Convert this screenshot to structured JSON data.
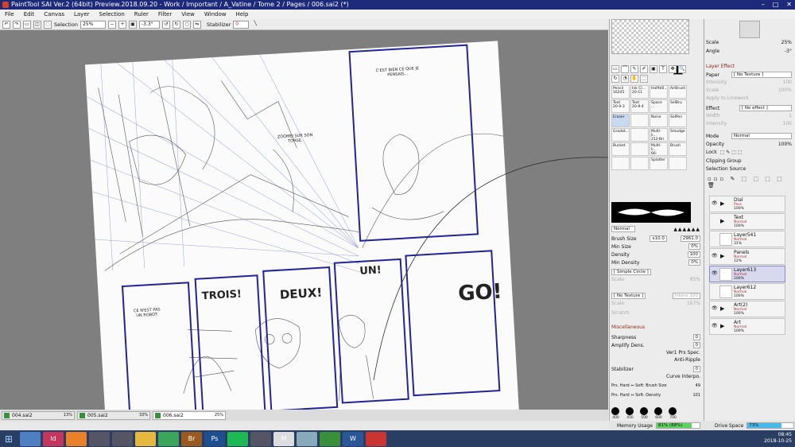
{
  "window": {
    "title": "PaintTool SAI Ver.2 (64bit) Preview.2018.09.20 - Work / Important / A_Vatine / Tome 2 / Pages / 006.sai2 (*)",
    "minimize": "–",
    "maximize": "□",
    "close": "✕"
  },
  "menu": [
    "File",
    "Edit",
    "Canvas",
    "Layer",
    "Selection",
    "Ruler",
    "Filter",
    "View",
    "Window",
    "Help"
  ],
  "toolbar": {
    "selection_label": "Selection",
    "zoom": "25%",
    "angle": "-3.3°",
    "stabilizer_label": "Stabilizer",
    "stabilizer_value": "0"
  },
  "comic": {
    "bubble1": "C'EST BIEN CE QUE JE PENSAIS...",
    "bubble2": "ZOOMEI SUR SON TORSE.",
    "bubble3": "CE N'EST PAS UN ROBOT.",
    "sfx_trois": "TROIS!",
    "sfx_deux": "DEUX!",
    "sfx_un": "UN!",
    "sfx_go": "GO!"
  },
  "file_tabs": [
    {
      "name": "004.sai2",
      "zoom": "13%"
    },
    {
      "name": "005.sai2",
      "zoom": "33%"
    },
    {
      "name": "006.sai2",
      "zoom": "25%"
    }
  ],
  "tools": {
    "icons": [
      "▭",
      "⌒",
      "✎",
      "✐",
      "▣",
      "T",
      "✥",
      "🔍",
      "↻",
      "◔",
      "✋",
      "⬚"
    ],
    "brushes": [
      {
        "name": "Pencil",
        "size": "16245"
      },
      {
        "name": "Ink Cl...",
        "size": "20-11"
      },
      {
        "name": "Halftd0...",
        "size": ""
      },
      {
        "name": "AirBrush",
        "size": ""
      },
      {
        "name": "Text",
        "size": "20-9-3"
      },
      {
        "name": "Text",
        "size": "20-9-4"
      },
      {
        "name": "Space ...",
        "size": ""
      },
      {
        "name": "SelBru",
        "size": ""
      },
      {
        "name": "Eraser",
        "size": ""
      },
      {
        "name": "",
        "size": ""
      },
      {
        "name": "Noise",
        "size": ""
      },
      {
        "name": "SelPen",
        "size": ""
      },
      {
        "name": "Gradat...",
        "size": ""
      },
      {
        "name": "",
        "size": ""
      },
      {
        "name": "Multi-li...",
        "size": "212-Bri"
      },
      {
        "name": "Smudge",
        "size": ""
      },
      {
        "name": "Bucket",
        "size": ""
      },
      {
        "name": "",
        "size": ""
      },
      {
        "name": "Multi-li...",
        "size": "66-Bright"
      },
      {
        "name": "Brush",
        "size": ""
      },
      {
        "name": "",
        "size": ""
      },
      {
        "name": "",
        "size": ""
      },
      {
        "name": "Splatter",
        "size": ""
      },
      {
        "name": "",
        "size": ""
      }
    ],
    "blend_mode": "Normal",
    "brush_size_label": "Brush Size",
    "brush_size_mult": "x10.0",
    "brush_size": "2961.0",
    "min_size_label": "Min Size",
    "min_size": "0%",
    "density_label": "Density",
    "density": "100",
    "min_density_label": "Min Density",
    "min_density": "0%",
    "shape": "[ Simple Circle ]",
    "shape_scale_label": "Scale",
    "shape_scale": "95%",
    "texture": "[ No Texture ]",
    "texture_scale_label": "Scale",
    "texture_scale": "167%",
    "texture_intensity": "Intens 100",
    "scratch": "Scratch",
    "misc_title": "Miscellaneous",
    "sharpness_label": "Sharpness",
    "sharpness": "0",
    "amplify_label": "Amplify Dens.",
    "amplify": "0",
    "ver1": "Ver1 Prs Spec.",
    "antiripple": "Anti-Ripple",
    "stabilizer_label": "Stabilizer",
    "stabilizer": "0",
    "curve": "Curve Interpo.",
    "prs_size": "Prs. Hard ⇔ Soft: Brush Size",
    "prs_size_val": "49",
    "prs_density": "Prs. Hard ⇔ Soft: Density",
    "prs_density_val": "101",
    "dot_sizes": [
      "400",
      "450",
      "500",
      "600",
      "700"
    ]
  },
  "right": {
    "scale_label": "Scale",
    "scale": "25%",
    "angle_label": "Angle",
    "angle": "-3°",
    "layer_effect_title": "Layer Effect",
    "paper_label": "Paper",
    "paper_value": "[ No Texture ]",
    "intensity_label": "Intensity",
    "intensity": "100",
    "scale2_label": "Scale",
    "scale2": "100%",
    "apply_lineart": "Apply to Linework",
    "effect_label": "Effect",
    "effect_value": "[ No effect ]",
    "width_label": "Width",
    "width": "1",
    "intensity2_label": "Intensity",
    "intensity2": "100",
    "mode_label": "Mode",
    "mode_value": "Normal",
    "opacity_label": "Opacity",
    "opacity": "100%",
    "lock_label": "Lock",
    "clipping_group": "Clipping Group",
    "selection_source": "Selection Source",
    "layers": [
      {
        "name": "Dial",
        "mode": "Pass",
        "opacity": "100%",
        "folder": true,
        "visible": true,
        "selected": false
      },
      {
        "name": "Text",
        "mode": "Normal",
        "opacity": "100%",
        "folder": true,
        "visible": false,
        "selected": false
      },
      {
        "name": "Layer541",
        "mode": "Normal",
        "opacity": "31%",
        "folder": false,
        "visible": false,
        "selected": false
      },
      {
        "name": "Panels",
        "mode": "Normal",
        "opacity": "12%",
        "folder": true,
        "visible": true,
        "selected": false
      },
      {
        "name": "Layer613",
        "mode": "Normal",
        "opacity": "100%",
        "folder": false,
        "visible": true,
        "selected": true
      },
      {
        "name": "Layer612",
        "mode": "Normal",
        "opacity": "100%",
        "folder": false,
        "visible": false,
        "selected": false
      },
      {
        "name": "Art(2)",
        "mode": "Normal",
        "opacity": "100%",
        "folder": true,
        "visible": true,
        "selected": false
      },
      {
        "name": "Art",
        "mode": "Normal",
        "opacity": "100%",
        "folder": true,
        "visible": true,
        "selected": false
      }
    ]
  },
  "status": {
    "memory_label": "Memory Usage",
    "memory_value": "81% (88%)",
    "memory_fraction": 0.81,
    "drive_label": "Drive Space",
    "drive_value": "73%",
    "drive_fraction": 0.73
  },
  "taskbar": {
    "start_icon": "windows-logo",
    "apps": [
      {
        "name": "explorer-hub",
        "label": "",
        "color": "#4f7ec2"
      },
      {
        "name": "indesign",
        "label": "Id",
        "color": "#c6355d"
      },
      {
        "name": "firefox",
        "label": "",
        "color": "#e8812a"
      },
      {
        "name": "app-4",
        "label": "",
        "color": "#556"
      },
      {
        "name": "app-5",
        "label": "",
        "color": "#556"
      },
      {
        "name": "folder",
        "label": "",
        "color": "#e6b83e"
      },
      {
        "name": "chrome",
        "label": "",
        "color": "#3ba55c"
      },
      {
        "name": "bridge",
        "label": "Br",
        "color": "#9a5a20"
      },
      {
        "name": "photoshop",
        "label": "Ps",
        "color": "#1e4f8f"
      },
      {
        "name": "spotify",
        "label": "",
        "color": "#1db954"
      },
      {
        "name": "app-11",
        "label": "",
        "color": "#556"
      },
      {
        "name": "app-12",
        "label": "M",
        "color": "#ddd"
      },
      {
        "name": "app-13",
        "label": "",
        "color": "#8ab"
      },
      {
        "name": "app-14",
        "label": "",
        "color": "#3a8f3a"
      },
      {
        "name": "word",
        "label": "W",
        "color": "#2b5797"
      },
      {
        "name": "paintsai",
        "label": "",
        "color": "#c33"
      }
    ],
    "time": "08:45",
    "date": "2018-10-25"
  }
}
